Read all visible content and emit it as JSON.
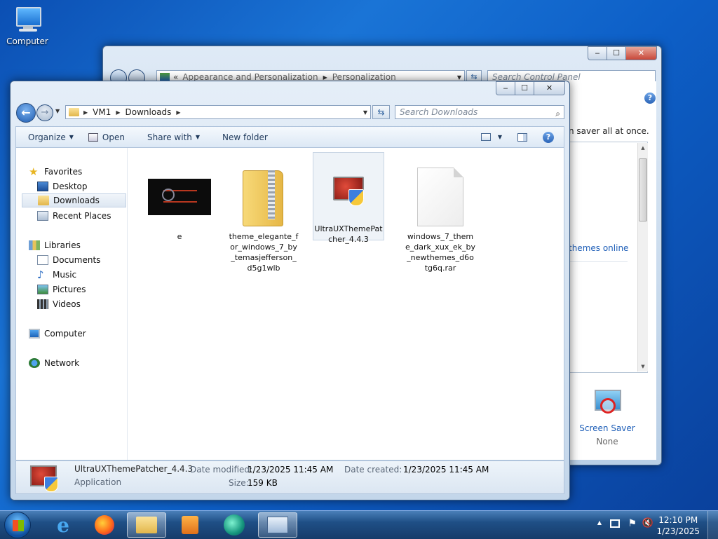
{
  "desktop": {
    "computer_label": "Computer"
  },
  "control_panel": {
    "breadcrumb": [
      "Appearance and Personalization",
      "Personalization"
    ],
    "search_placeholder": "Search Control Panel",
    "text_fragment": "n saver all at once.",
    "link_fragment": "themes online",
    "screen_saver_label": "Screen Saver",
    "screen_saver_value": "None"
  },
  "explorer": {
    "breadcrumb": [
      "VM1",
      "Downloads"
    ],
    "search_placeholder": "Search Downloads",
    "toolbar": {
      "organize": "Organize",
      "open": "Open",
      "share_with": "Share with",
      "new_folder": "New folder"
    },
    "nav": {
      "favorites": "Favorites",
      "desktop": "Desktop",
      "downloads": "Downloads",
      "recent": "Recent Places",
      "libraries": "Libraries",
      "documents": "Documents",
      "music": "Music",
      "pictures": "Pictures",
      "videos": "Videos",
      "computer": "Computer",
      "network": "Network"
    },
    "files": [
      {
        "name": "e"
      },
      {
        "name": "theme_elegante_for_windows_7_by_temasjefferson_d5g1wlb"
      },
      {
        "name": "UltraUXThemePatcher_4.4.3"
      },
      {
        "name": "windows_7_theme_dark_xux_ek_by_newthemes_d6otg6q.rar"
      }
    ],
    "details": {
      "name": "UltraUXThemePatcher_4.4.3",
      "type": "Application",
      "modified_label": "Date modified:",
      "modified_value": "1/23/2025 11:45 AM",
      "created_label": "Date created:",
      "created_value": "1/23/2025 11:45 AM",
      "size_label": "Size:",
      "size_value": "159 KB"
    }
  },
  "taskbar": {
    "time": "12:10 PM",
    "date": "1/23/2025"
  },
  "colors": {
    "accent": "#1e395b",
    "link": "#1f5fb8",
    "selection": "#dde7f2"
  }
}
